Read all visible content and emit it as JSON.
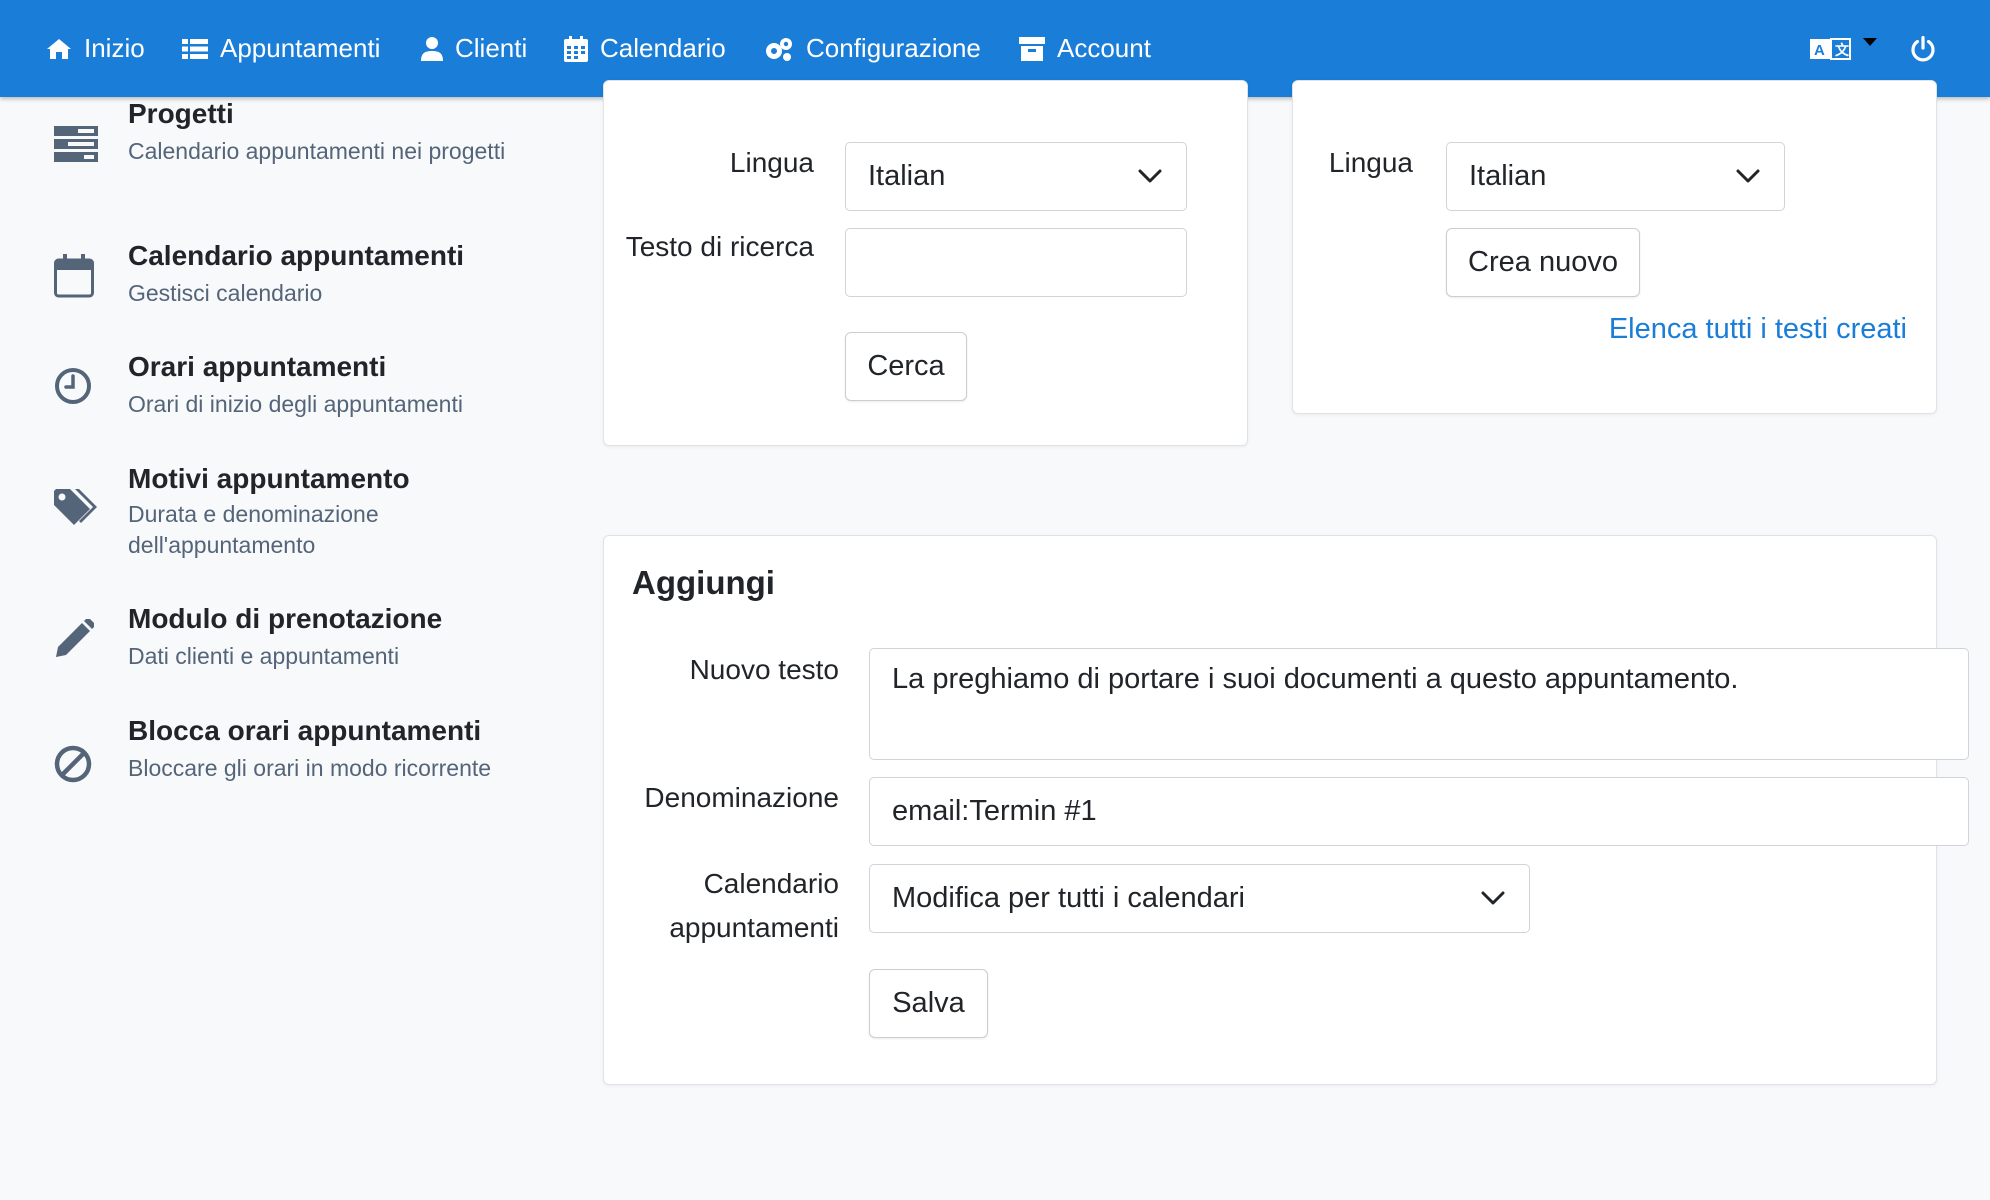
{
  "nav": {
    "items": [
      {
        "label": "Inizio",
        "icon": "home-icon"
      },
      {
        "label": "Appuntamenti",
        "icon": "list-icon"
      },
      {
        "label": "Clienti",
        "icon": "user-icon"
      },
      {
        "label": "Calendario",
        "icon": "calendar-icon"
      },
      {
        "label": "Configurazione",
        "icon": "cogs-icon"
      },
      {
        "label": "Account",
        "icon": "archive-icon"
      }
    ],
    "language_icon": "language-icon",
    "power_icon": "power-icon"
  },
  "sidebar": {
    "items": [
      {
        "title": "Progetti",
        "desc": "Calendario appuntamenti nei progetti",
        "icon": "projects-icon"
      },
      {
        "title": "Calendario appuntamenti",
        "desc": "Gestisci calendario",
        "icon": "calendar-icon"
      },
      {
        "title": "Orari appuntamenti",
        "desc": "Orari di inizio degli appuntamenti",
        "icon": "clock-icon"
      },
      {
        "title": "Motivi appuntamento",
        "desc": "Durata e denominazione dell'appuntamento",
        "icon": "tags-icon"
      },
      {
        "title": "Modulo di prenotazione",
        "desc": "Dati clienti e appuntamenti",
        "icon": "pencil-icon"
      },
      {
        "title": "Blocca orari appuntamenti",
        "desc": "Bloccare gli orari in modo ricorrente",
        "icon": "ban-icon"
      }
    ]
  },
  "search_card": {
    "language_label": "Lingua",
    "language_value": "Italian",
    "search_label": "Testo di ricerca",
    "search_value": "",
    "search_button": "Cerca"
  },
  "create_card": {
    "language_label": "Lingua",
    "language_value": "Italian",
    "create_button": "Crea nuovo",
    "list_link": "Elenca tutti i testi creati"
  },
  "add_card": {
    "title": "Aggiungi",
    "new_text_label": "Nuovo testo",
    "new_text_value": "La preghiamo di portare i suoi documenti a questo appuntamento.",
    "name_label": "Denominazione",
    "name_value": "email:Termin #1",
    "calendar_label": "Calendario appuntamenti",
    "calendar_value": "Modifica per tutti i calendari",
    "save_button": "Salva"
  }
}
